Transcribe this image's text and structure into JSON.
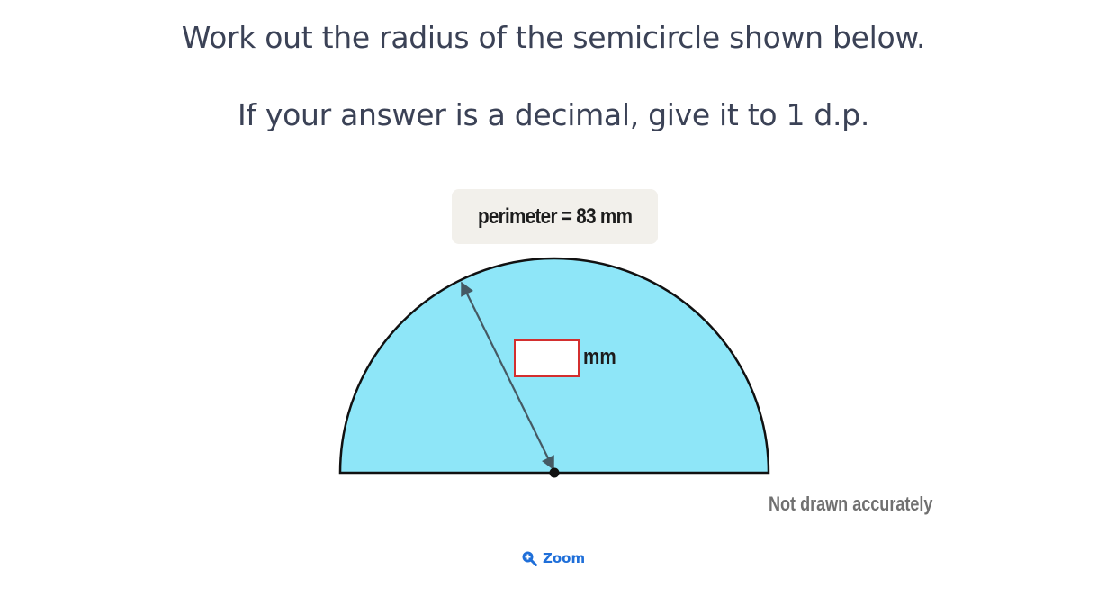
{
  "question": {
    "line1": "Work out the radius of the semicircle shown below.",
    "line2": "If your answer is a decimal, give it to 1 d.p."
  },
  "diagram": {
    "perimeter_label": "perimeter = 83 mm",
    "answer_value": "",
    "unit_label": "mm",
    "not_drawn_note": "Not drawn accurately",
    "fill_color": "#8ee6f8",
    "outline_color": "#111111",
    "radius_line_color": "#455a64",
    "input_border_color": "#d32f2f"
  },
  "zoom": {
    "label": "Zoom",
    "icon": "zoom-in-icon",
    "color": "#1f6fd9"
  }
}
